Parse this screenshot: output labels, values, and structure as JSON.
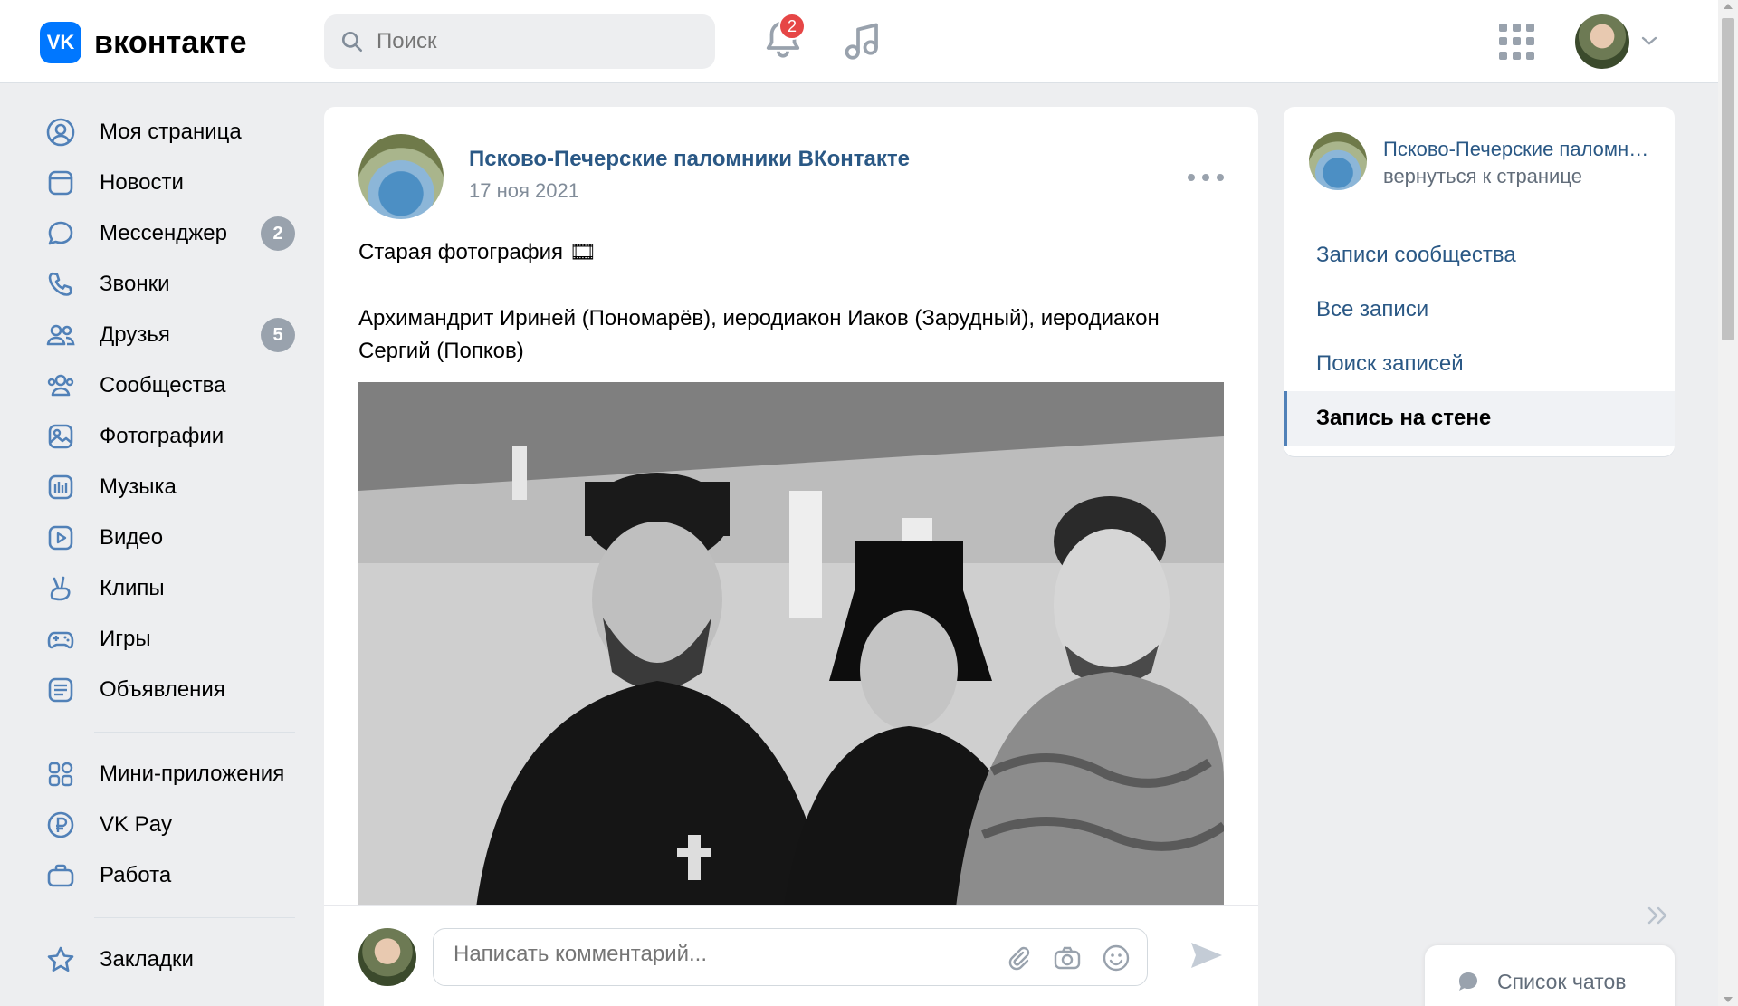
{
  "header": {
    "logo_text": "вконтакте",
    "logo_badge": "VK",
    "search_placeholder": "Поиск",
    "notifications_count": "2"
  },
  "leftnav": {
    "items": [
      {
        "label": "Моя страница"
      },
      {
        "label": "Новости"
      },
      {
        "label": "Мессенджер",
        "count": "2"
      },
      {
        "label": "Звонки"
      },
      {
        "label": "Друзья",
        "count": "5"
      },
      {
        "label": "Сообщества"
      },
      {
        "label": "Фотографии"
      },
      {
        "label": "Музыка"
      },
      {
        "label": "Видео"
      },
      {
        "label": "Клипы"
      },
      {
        "label": "Игры"
      },
      {
        "label": "Объявления"
      },
      {
        "label": "Мини-приложения"
      },
      {
        "label": "VK Pay"
      },
      {
        "label": "Работа"
      },
      {
        "label": "Закладки"
      }
    ]
  },
  "post": {
    "author": "Псково-Печерские паломники ВКонтакте",
    "date": "17 ноя 2021",
    "text_line1": "Старая фотография 🎞",
    "text_line2": "Архимандрит Ириней (Пономарёв), иеродиакон Иаков (Зарудный), иеродиакон Сергий (Попков)"
  },
  "comment": {
    "placeholder": "Написать комментарий..."
  },
  "rightbox": {
    "title": "Псково-Печерские паломники ВКонтакте",
    "back": "вернуться к странице",
    "links": [
      "Записи сообщества",
      "Все записи",
      "Поиск записей"
    ],
    "active": "Запись на стене"
  },
  "chats": {
    "label": "Список чатов"
  },
  "colors": {
    "accent": "#0077ff",
    "link": "#2a5885",
    "badge_red": "#e64646",
    "count_gray": "#99a2ad"
  }
}
